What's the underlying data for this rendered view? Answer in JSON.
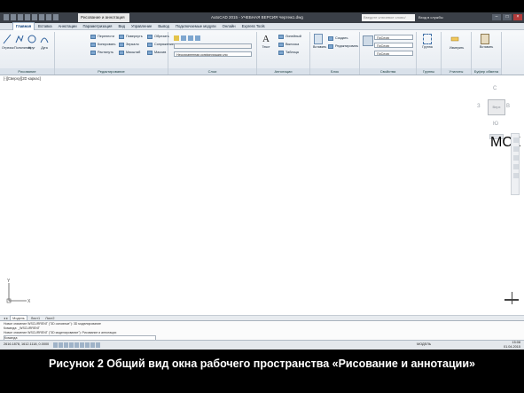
{
  "titlebar": {
    "workspace": "Рисование и аннотация",
    "app_title": "AutoCAD 2015 - УЧЕБНАЯ ВЕРСИЯ  Чертеж1.dwg",
    "search_placeholder": "Введите ключевое слово/фразу",
    "signin": "Вход в службы"
  },
  "tabs": [
    "Главная",
    "Вставка",
    "Аннотации",
    "Параметризация",
    "Вид",
    "Управление",
    "Вывод",
    "Подключаемые модули",
    "Онлайн",
    "Express Tools"
  ],
  "ribbon": {
    "draw": {
      "title": "Рисование",
      "buttons": [
        "Отрезок",
        "Полилиния",
        "Круг",
        "Дуга"
      ]
    },
    "modify": {
      "title": "Редактирование",
      "items": [
        "Перенести",
        "Повернуть",
        "Обрезать",
        "Копировать",
        "Зеркало",
        "Сопряжение",
        "Растянуть",
        "Масштаб",
        "Массив"
      ]
    },
    "layers": {
      "title": "Слои",
      "combo": "Несохраненная конфигурация сло"
    },
    "annotation": {
      "title": "Аннотации",
      "text_button": "Текст",
      "dim_button": "Размер",
      "items": [
        "Линейный",
        "Выноска",
        "Таблица"
      ]
    },
    "block": {
      "title": "Блок",
      "insert_button": "Вставить",
      "items": [
        "Создать",
        "Редактировать"
      ]
    },
    "properties": {
      "title": "Свойства",
      "combos": [
        "ПоСлою",
        "ПоСлою",
        "ПоСлою"
      ]
    },
    "groups": {
      "title": "Группы",
      "button": "Группа"
    },
    "utilities": {
      "title": "Утилиты",
      "button": "Измерить"
    },
    "clipboard": {
      "title": "Буфер обмена",
      "button": "Вставить"
    }
  },
  "drawing": {
    "view_label": "[-][Сверху][2D каркас]",
    "viewcube": {
      "north": "С",
      "south": "Ю",
      "west": "З",
      "east": "В",
      "face": "Верх"
    },
    "navbar_label": "МСК",
    "ucs_x": "X",
    "ucs_y": "Y"
  },
  "layout_tabs": [
    "Модель",
    "Лист1",
    "Лист2"
  ],
  "command": {
    "lines": [
      "Новое значение WSCURRENT (\"3D основные\"): 3D моделирование",
      "Команда: _WSCURRENT",
      "Новое значение WSCURRENT (\"3D моделирование\"): Рисование и аннотации"
    ],
    "prompt": "Команда:"
  },
  "statusbar": {
    "coords": "2616.1878, 1612.1118, 0.0000",
    "mode": "МОДЕЛЬ",
    "time": "15:08",
    "date": "01.04.2015"
  },
  "caption": "Рисунок 2 Общий вид окна рабочего пространства «Рисование и аннотации»"
}
